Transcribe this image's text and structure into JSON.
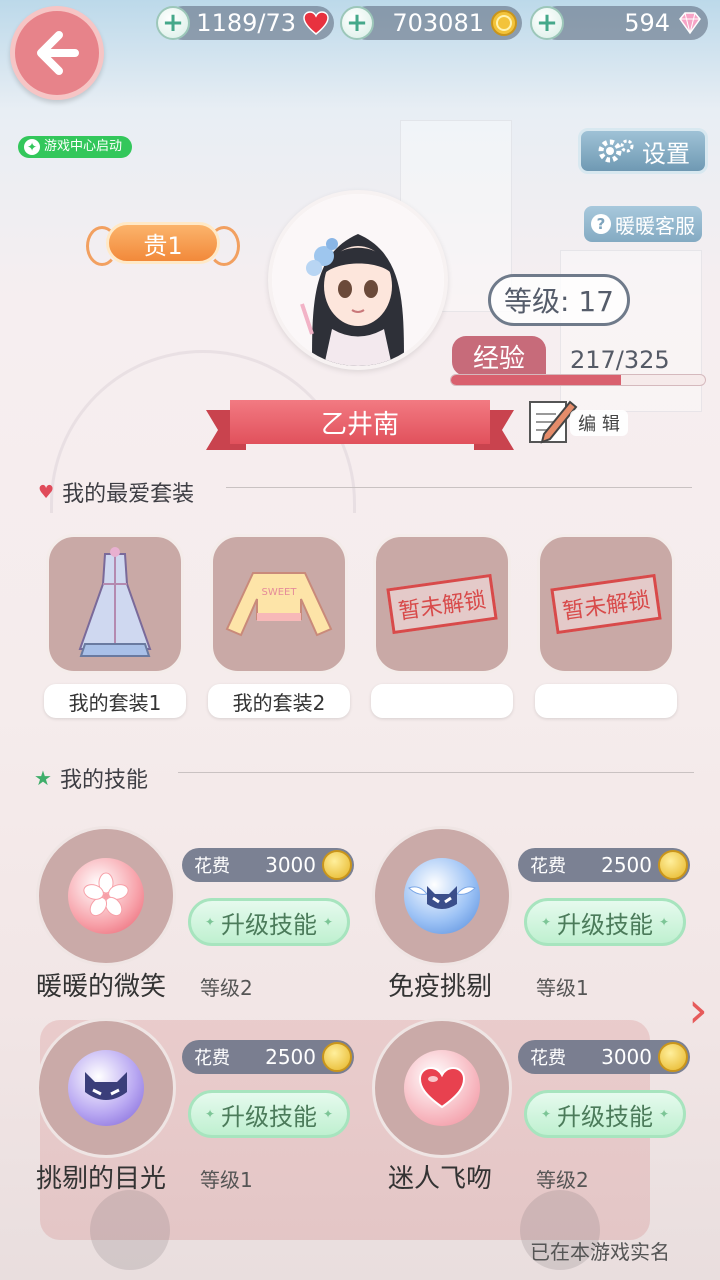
{
  "header": {
    "back_icon": "back-arrow-icon",
    "stamina": {
      "value": "1189/73",
      "icon": "heart-icon"
    },
    "coins": {
      "value": "703081",
      "icon": "coin-icon"
    },
    "diamonds": {
      "value": "594",
      "icon": "diamond-icon"
    }
  },
  "game_center_badge": "游戏中心启动",
  "settings_label": "设置",
  "customer_service_label": "暖暖客服",
  "vip_label": "贵1",
  "level_text": "等级: 17",
  "exp": {
    "label": "经验",
    "value": "217/325",
    "progress": 0.668
  },
  "player_name": "乙井南",
  "edit_label": "编 辑",
  "favorite_outfits": {
    "title": "我的最爱套装",
    "items": [
      {
        "label": "我的套装1",
        "locked": false
      },
      {
        "label": "我的套装2",
        "locked": false,
        "shirt_text": "SWEET"
      },
      {
        "label": "",
        "locked": true,
        "stamp": "暂未解锁"
      },
      {
        "label": "",
        "locked": true,
        "stamp": "暂未解锁"
      }
    ]
  },
  "skills": {
    "title": "我的技能",
    "cost_label": "花费",
    "upgrade_label": "升级技能",
    "items": [
      {
        "name": "暖暖的微笑",
        "level": "等级2",
        "cost": "3000",
        "icon": "sakura-icon"
      },
      {
        "name": "免疫挑剔",
        "level": "等级1",
        "cost": "2500",
        "icon": "winged-mask-icon"
      },
      {
        "name": "挑剔的目光",
        "level": "等级1",
        "cost": "2500",
        "icon": "cat-mask-icon"
      },
      {
        "name": "迷人飞吻",
        "level": "等级2",
        "cost": "3000",
        "icon": "heart-icon"
      }
    ]
  },
  "footer_text": "已在本游戏实名",
  "colors": {
    "accent_pink": "#e1515c",
    "vip_orange": "#f2893a",
    "upgrade_green": "#bff0d0",
    "badge_green": "#33c75b"
  }
}
